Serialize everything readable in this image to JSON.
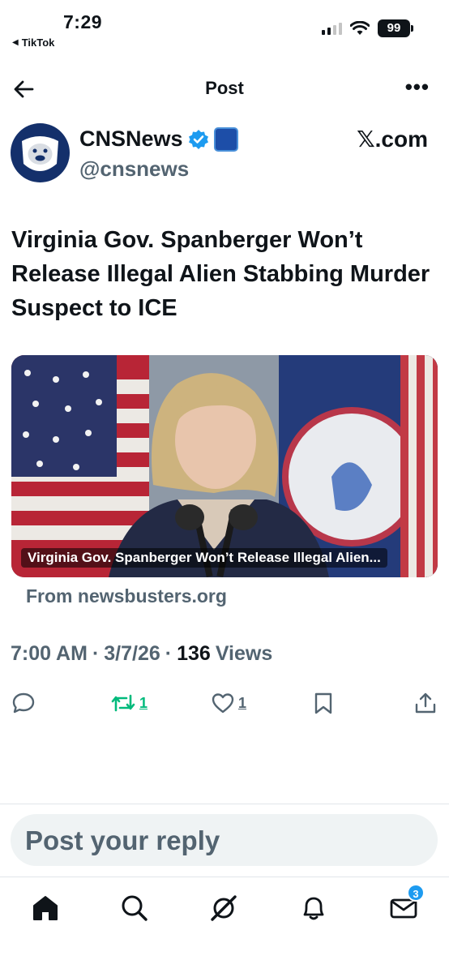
{
  "status_bar": {
    "time": "7:29",
    "back_app": "TikTok",
    "battery": "99"
  },
  "header": {
    "title": "Post"
  },
  "author": {
    "name": "CNSNews",
    "handle": "@cnsnews",
    "source": "𝕏.com"
  },
  "post": {
    "text": "Virginia Gov. Spanberger Won’t Release Illegal Alien Stabbing Murder Suspect to ICE",
    "card": {
      "caption": "Virginia Gov. Spanberger Won’t Release Illegal Alien...",
      "from": "From newsbusters.org"
    },
    "meta": {
      "time": "7:00 AM",
      "date": "3/7/26",
      "views_count": "136",
      "views_label": "Views",
      "sep": "·"
    }
  },
  "actions": {
    "retweets": "1",
    "likes": "1"
  },
  "reply": {
    "placeholder": "Post your reply"
  },
  "nav": {
    "messages_badge": "3"
  },
  "colors": {
    "accent": "#1d9bf0",
    "retweet_green": "#00ba7c",
    "muted": "#536471"
  }
}
